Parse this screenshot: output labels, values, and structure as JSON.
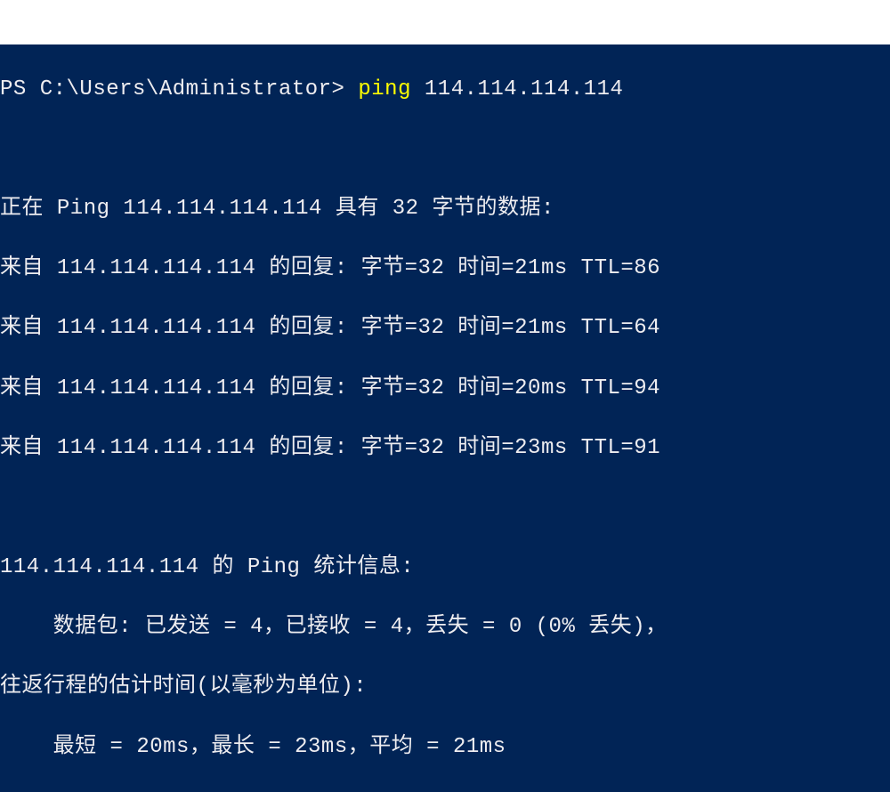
{
  "terminal": {
    "prompt": "PS C:\\Users\\Administrator>",
    "command": "ping",
    "command_arg": "114.114.114.114",
    "lines": {
      "pinging": "正在 Ping 114.114.114.114 具有 32 字节的数据:",
      "reply1": "来自 114.114.114.114 的回复: 字节=32 时间=21ms TTL=86",
      "reply2": "来自 114.114.114.114 的回复: 字节=32 时间=21ms TTL=64",
      "reply3": "来自 114.114.114.114 的回复: 字节=32 时间=20ms TTL=94",
      "reply4": "来自 114.114.114.114 的回复: 字节=32 时间=23ms TTL=91",
      "stats_header": "114.114.114.114 的 Ping 统计信息:",
      "stats_packets": "    数据包: 已发送 = 4，已接收 = 4，丢失 = 0 (0% 丢失)，",
      "rtt_header": "往返行程的估计时间(以毫秒为单位):",
      "rtt_values": "    最短 = 20ms，最长 = 23ms，平均 = 21ms"
    }
  }
}
